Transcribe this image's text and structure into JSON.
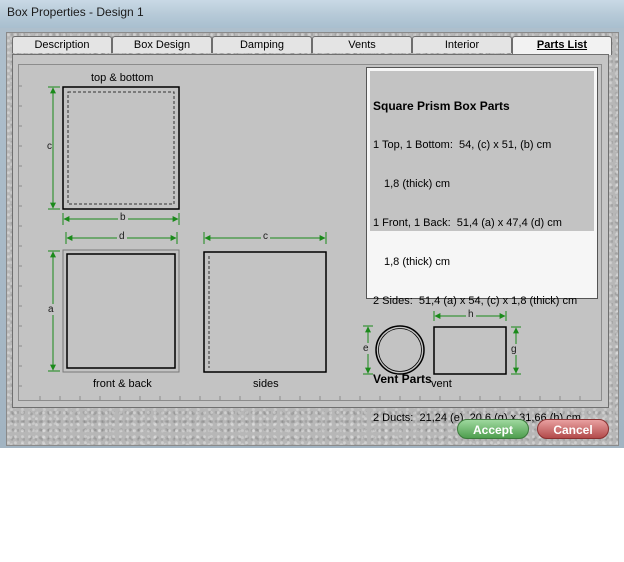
{
  "window": {
    "title": "Box Properties - Design 1"
  },
  "tabs": [
    {
      "label": "Description"
    },
    {
      "label": "Box Design"
    },
    {
      "label": "Damping"
    },
    {
      "label": "Vents"
    },
    {
      "label": "Interior"
    },
    {
      "label": "Parts List",
      "active": true
    }
  ],
  "diagram": {
    "top_bottom_label": "top & bottom",
    "front_back_label": "front & back",
    "sides_label": "sides",
    "vent_label": "vent",
    "dims": {
      "a": "a",
      "b": "b",
      "c": "c",
      "d": "d",
      "e": "e",
      "g": "g",
      "h": "h"
    },
    "dimension_color": "#1a8a1a"
  },
  "parts_list": {
    "heading1": "Square Prism Box Parts",
    "line1": "1 Top, 1 Bottom:  54, (c) x 51, (b) cm",
    "line1b": "1,8 (thick) cm",
    "line2": "1 Front, 1 Back:  51,4 (a) x 47,4 (d) cm",
    "line2b": "1,8 (thick) cm",
    "line3": "2 Sides:  51,4 (a) x 54, (c) x 1,8 (thick) cm",
    "heading2": "Vent Parts",
    "line4": "2 Ducts:  21,24 (e), 20,6 (g) x 31,66 (h) cm"
  },
  "buttons": {
    "accept": "Accept",
    "cancel": "Cancel"
  }
}
